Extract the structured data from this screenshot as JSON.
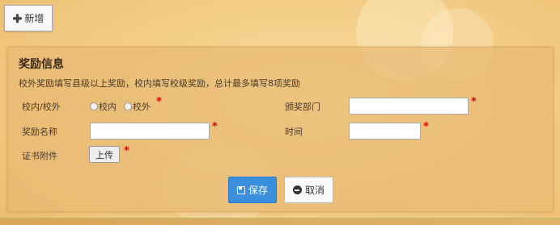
{
  "toolbar": {
    "add_label": "新增"
  },
  "panel": {
    "title": "奖励信息",
    "subtitle": "校外奖励填写县级以上奖励，校内填写校级奖励，总计最多填写8项奖励"
  },
  "form": {
    "scope_label": "校内/校外",
    "scope_options": [
      "校内",
      "校外"
    ],
    "department_label": "颁奖部门",
    "department_value": "",
    "award_name_label": "奖励名称",
    "award_name_value": "",
    "time_label": "时间",
    "time_value": "",
    "attachment_label": "证书附件",
    "upload_label": "上传",
    "required_mark": "*"
  },
  "actions": {
    "save_label": "保存",
    "cancel_label": "取消"
  }
}
